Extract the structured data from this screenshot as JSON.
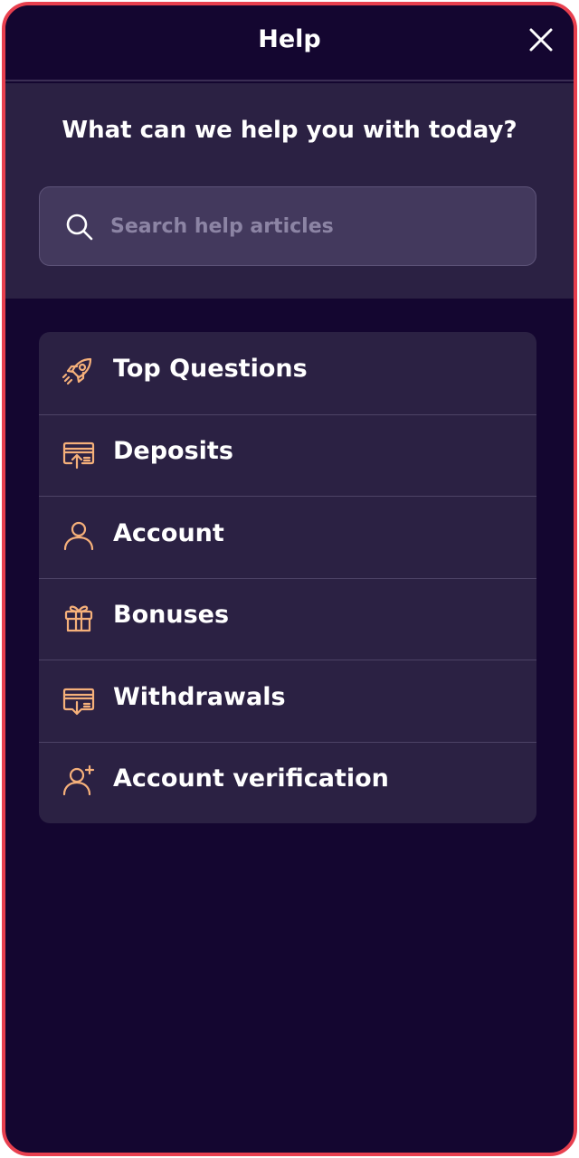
{
  "header": {
    "title": "Help",
    "close_icon": "close-icon"
  },
  "hero": {
    "title": "What can we help you with today?",
    "search": {
      "placeholder": "Search help articles",
      "value": "",
      "icon": "search-icon"
    }
  },
  "menu": {
    "items": [
      {
        "label": "Top Questions",
        "icon": "rocket-icon"
      },
      {
        "label": "Deposits",
        "icon": "deposit-icon"
      },
      {
        "label": "Account",
        "icon": "user-icon"
      },
      {
        "label": "Bonuses",
        "icon": "gift-icon"
      },
      {
        "label": "Withdrawals",
        "icon": "withdraw-icon"
      },
      {
        "label": "Account verification",
        "icon": "user-add-icon"
      }
    ]
  },
  "colors": {
    "frame_border": "#e8404f",
    "background": "#140630",
    "panel": "#2b2143",
    "search_bg": "#43395d",
    "icon_accent": "#f5b07a",
    "text": "#ffffff",
    "placeholder": "#8c84a4"
  }
}
